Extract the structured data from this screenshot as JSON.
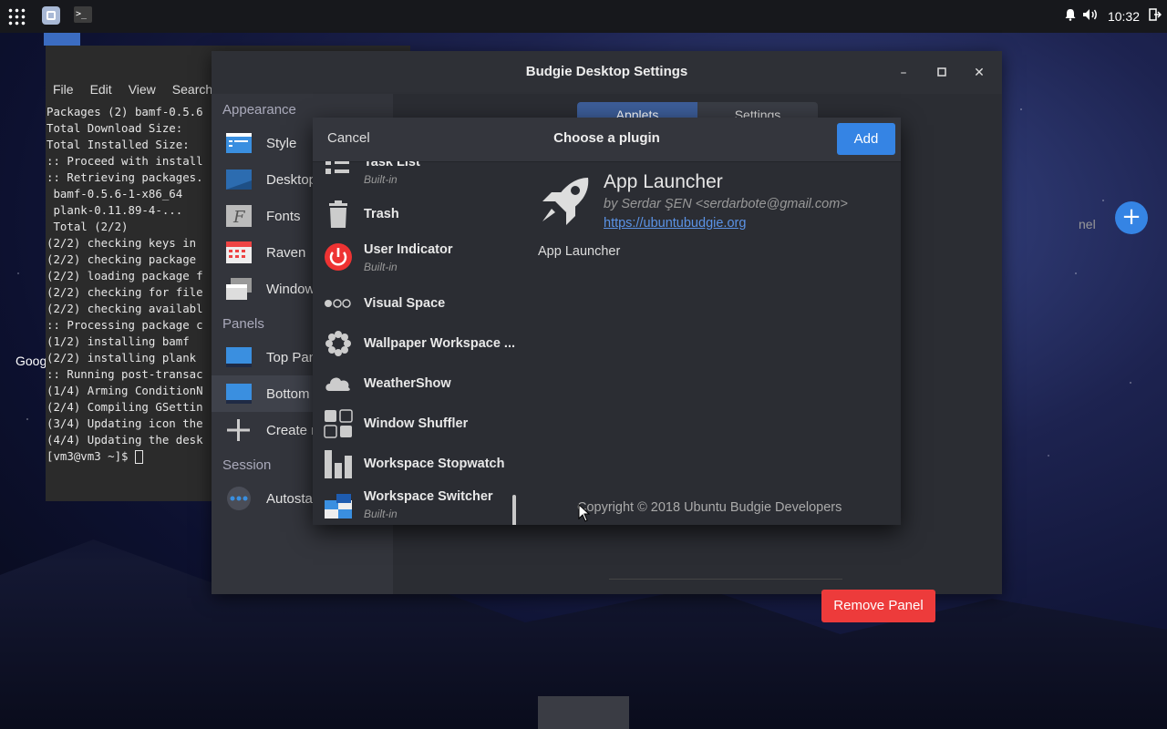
{
  "topbar": {
    "clock": "10:32",
    "icons": [
      "apps-grid-icon",
      "launcher-icon",
      "terminal-icon",
      "bell-icon",
      "volume-icon",
      "logout-icon"
    ]
  },
  "terminal": {
    "menu": [
      "File",
      "Edit",
      "View",
      "Search"
    ],
    "lines": [
      "Packages (2) bamf-0.5.6",
      "",
      "Total Download Size:",
      "Total Installed Size:",
      "",
      ":: Proceed with install",
      ":: Retrieving packages.",
      " bamf-0.5.6-1-x86_64",
      " plank-0.11.89-4-...",
      " Total (2/2)",
      "(2/2) checking keys in",
      "(2/2) checking package",
      "(2/2) loading package f",
      "(2/2) checking for file",
      "(2/2) checking availabl",
      ":: Processing package c",
      "(1/2) installing bamf",
      "(2/2) installing plank",
      ":: Running post-transac",
      "(1/4) Arming ConditionN",
      "(2/4) Compiling GSettin",
      "(3/4) Updating icon the",
      "(4/4) Updating the desk",
      "[vm3@vm3 ~]$ "
    ]
  },
  "desktop": {
    "partial_label": "Goog"
  },
  "settings": {
    "title": "Budgie Desktop Settings",
    "sections": {
      "appearance": "Appearance",
      "panels": "Panels",
      "session": "Session"
    },
    "sidebar_items": {
      "style": "Style",
      "desktop": "Desktop",
      "fonts": "Fonts",
      "raven": "Raven",
      "windows": "Window",
      "top_panel": "Top Pan",
      "bottom_panel": "Bottom",
      "create_panel": "Create n",
      "autostart": "Autosta"
    },
    "tabs": [
      "Applets",
      "Settings"
    ],
    "panel_hint": "nel",
    "remove_panel": "Remove Panel"
  },
  "dialog": {
    "cancel": "Cancel",
    "title": "Choose a plugin",
    "add": "Add",
    "plugins": [
      {
        "name": "Task List",
        "sub": "Built-in",
        "icon": "task-list-icon"
      },
      {
        "name": "Trash",
        "sub": "",
        "icon": "trash-icon"
      },
      {
        "name": "User Indicator",
        "sub": "Built-in",
        "icon": "power-icon"
      },
      {
        "name": "Visual Space",
        "sub": "",
        "icon": "visual-space-icon"
      },
      {
        "name": "Wallpaper Workspace ...",
        "sub": "",
        "icon": "flower-icon"
      },
      {
        "name": "WeatherShow",
        "sub": "",
        "icon": "cloud-icon"
      },
      {
        "name": "Window Shuffler",
        "sub": "",
        "icon": "grid-icon"
      },
      {
        "name": "Workspace Stopwatch",
        "sub": "",
        "icon": "bars-icon"
      },
      {
        "name": "Workspace Switcher",
        "sub": "Built-in",
        "icon": "workspace-switcher-icon"
      }
    ],
    "detail": {
      "name": "App Launcher",
      "author": "by Serdar ŞEN <serdarbote@gmail.com>",
      "url": "https://ubuntubudgie.org",
      "description": "App Launcher",
      "copyright": "Copyright © 2018 Ubuntu Budgie Developers"
    }
  },
  "colors": {
    "accent": "#3584e4",
    "danger": "#ed3b3b",
    "window_bg": "#2b2d33"
  }
}
